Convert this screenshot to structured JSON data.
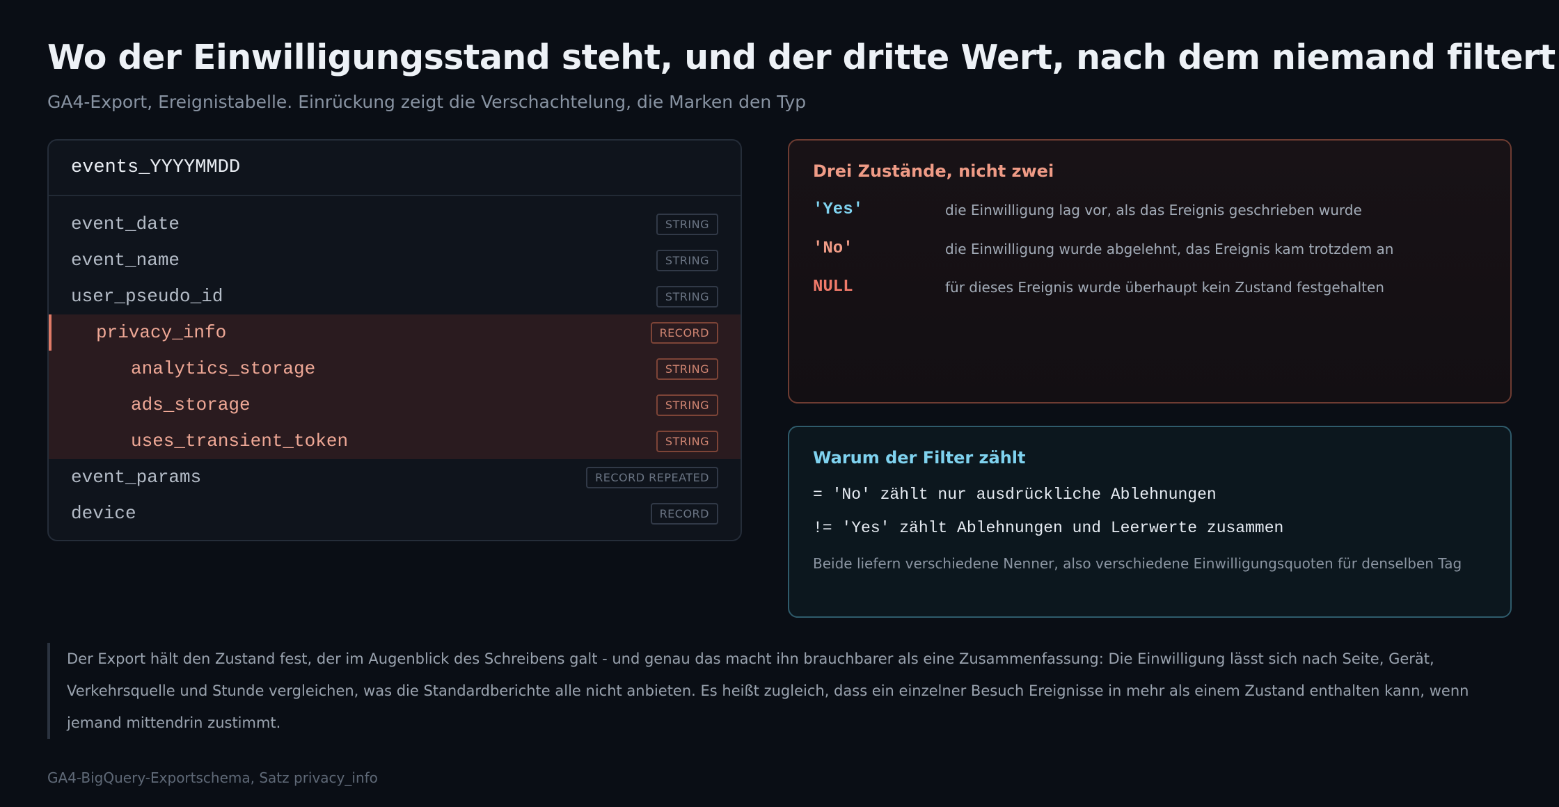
{
  "title": "Wo der Einwilligungsstand steht, und der dritte Wert, nach dem niemand filtert",
  "subtitle": "GA4-Export, Ereignistabelle. Einrückung zeigt die Verschachtelung, die Marken den Typ",
  "schema": {
    "table_name": "events_YYYYMMDD",
    "fields": [
      {
        "name": "event_date",
        "type": "STRING"
      },
      {
        "name": "event_name",
        "type": "STRING"
      },
      {
        "name": "user_pseudo_id",
        "type": "STRING"
      },
      {
        "name": "privacy_info",
        "type": "RECORD"
      },
      {
        "name": "analytics_storage",
        "type": "STRING"
      },
      {
        "name": "ads_storage",
        "type": "STRING"
      },
      {
        "name": "uses_transient_token",
        "type": "STRING"
      },
      {
        "name": "event_params",
        "type": "RECORD REPEATED"
      },
      {
        "name": "device",
        "type": "RECORD"
      }
    ]
  },
  "states_card": {
    "title": "Drei Zustände, nicht zwei",
    "states": [
      {
        "value": "'Yes'",
        "description": "die Einwilligung lag vor, als das Ereignis geschrieben wurde",
        "color": "#7fd2ef"
      },
      {
        "value": "'No'",
        "description": "die Einwilligung wurde abgelehnt, das Ereignis kam trotzdem an",
        "color": "#ef9b86"
      },
      {
        "value": "NULL",
        "description": "für dieses Ereignis wurde überhaupt kein Zustand festgehalten",
        "color": "#f07a6a"
      }
    ]
  },
  "filter_card": {
    "title": "Warum der Filter zählt",
    "lines": [
      "= 'No' zählt nur ausdrückliche Ablehnungen",
      "!= 'Yes' zählt Ablehnungen und Leerwerte zusammen"
    ],
    "note": "Beide liefern verschiedene Nenner, also verschiedene Einwilligungsquoten für denselben Tag"
  },
  "quote": "Der Export hält den Zustand fest, der im Augenblick des Schreibens galt - und genau das macht ihn brauchbarer als eine Zusammenfassung: Die Einwilligung lässt sich nach Seite, Gerät, Verkehrsquelle und Stunde vergleichen, was die Standardberichte alle nicht anbieten. Es heißt zugleich, dass ein einzelner Besuch Ereignisse in mehr als einem Zustand enthalten kann, wenn jemand mittendrin zustimmt.",
  "footer": "GA4-BigQuery-Exportschema, Satz privacy_info"
}
